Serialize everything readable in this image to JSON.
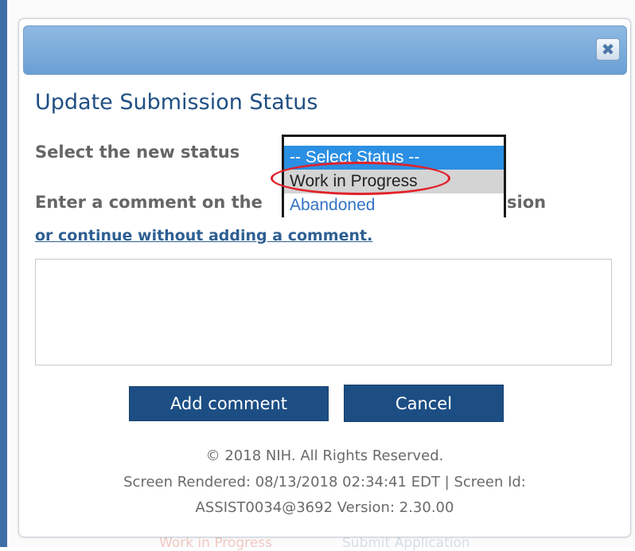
{
  "background": {
    "bottom_text_1": "Work in Progress",
    "bottom_text_2": "Submit Application"
  },
  "dialog": {
    "close_glyph": "✖",
    "title": "Update Submission Status",
    "status_label": "Select the new status",
    "comment_label": "Enter a comment on the",
    "comment_label_tail": "sion",
    "continue_link": "or continue without adding a comment.",
    "comment_value": "",
    "status_options": [
      "-- Select Status --",
      "Work in Progress",
      "Abandoned"
    ],
    "highlighted_option": "Work in Progress",
    "buttons": {
      "add_comment": "Add comment",
      "cancel": "Cancel"
    },
    "footer": {
      "copyright": "© 2018 NIH. All Rights Reserved.",
      "rendered": "Screen Rendered: 08/13/2018 02:34:41 EDT | Screen Id:",
      "screen_id_version": "ASSIST0034@3692  Version: 2.30.00"
    }
  },
  "colors": {
    "titlebar": "#7eaedc",
    "title_text": "#1f4f83",
    "button_bg": "#1c4e84",
    "selected_option_bg": "#2b8fe3",
    "hover_option_bg": "#d4d4d4",
    "highlight_ring": "#e0222a"
  }
}
